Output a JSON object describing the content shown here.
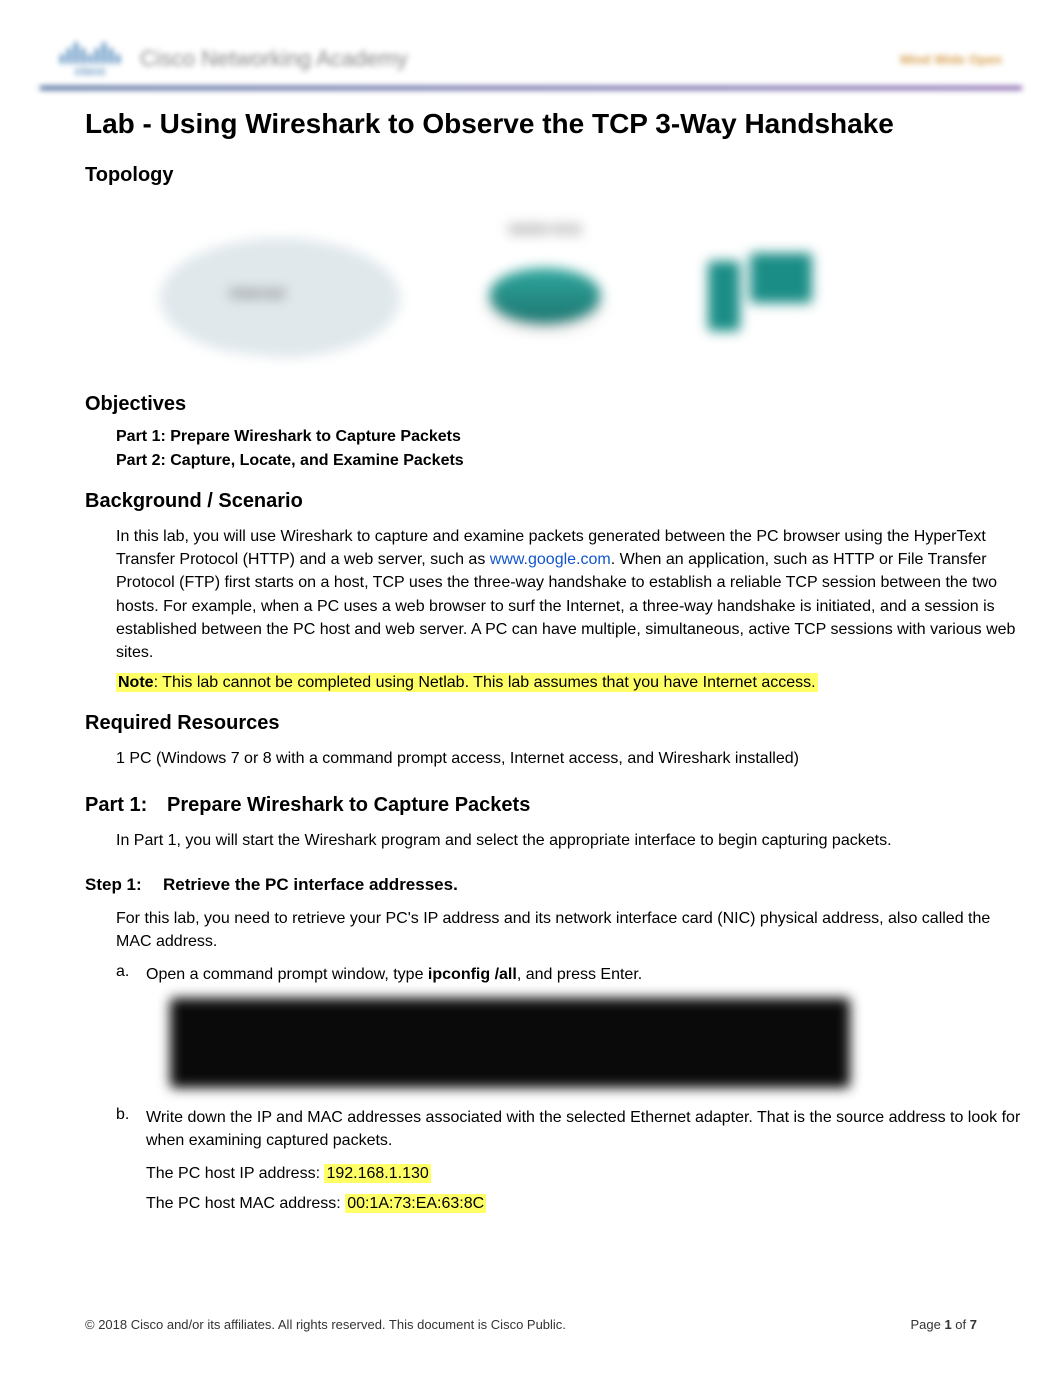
{
  "header": {
    "logo_text": "cisco",
    "academy": "Cisco Networking Academy",
    "tagline": "Mind Wide Open"
  },
  "title": "Lab - Using Wireshark to Observe the TCP 3-Way Handshake",
  "topology": {
    "heading": "Topology",
    "cloud_label": "Internet",
    "router_label": "S0/0/0 DCE",
    "pc_label": ""
  },
  "objectives": {
    "heading": "Objectives",
    "items": [
      "Part 1: Prepare Wireshark to Capture Packets",
      "Part 2: Capture, Locate, and Examine Packets"
    ]
  },
  "background": {
    "heading": "Background / Scenario",
    "para_pre": "In this lab, you will use Wireshark to capture and examine packets generated between the PC browser using the HyperText Transfer Protocol (HTTP) and a web server, such as ",
    "link_text": "www.google.com",
    "para_post": ". When an application, such as HTTP or File Transfer Protocol (FTP) first starts on a host, TCP uses the three-way handshake to establish a reliable TCP session between the two hosts. For example, when a PC uses a web browser to surf the Internet, a three-way handshake is initiated, and a session is established between the PC host and web server. A PC can have multiple, simultaneous, active TCP sessions with various web sites.",
    "note_label": "Note",
    "note_text": ": This lab cannot be completed using Netlab. This lab assumes that you have Internet access."
  },
  "resources": {
    "heading": "Required Resources",
    "item": "1 PC (Windows 7 or 8 with a command prompt access, Internet access, and Wireshark installed)"
  },
  "part1": {
    "num": "Part 1:",
    "title": "Prepare Wireshark to Capture Packets",
    "desc": "In Part 1, you will start the Wireshark program and select the appropriate interface to begin capturing packets."
  },
  "step1": {
    "num": "Step 1:",
    "title": "Retrieve the PC interface addresses.",
    "desc": "For this lab, you need to retrieve your PC's IP address and its network interface card (NIC) physical address, also called the MAC address.",
    "a_marker": "a.",
    "a_pre": "Open a command prompt window, type ",
    "a_cmd": "ipconfig /all",
    "a_post": ", and press Enter.",
    "b_marker": "b.",
    "b_text": "Write down the IP and MAC addresses associated with the selected Ethernet adapter. That is the source address to look for when examining captured packets.",
    "ip_label": "The PC host IP address: ",
    "ip_value": "192.168.1.130",
    "mac_label": "The PC host MAC address: ",
    "mac_value": "00:1A:73:EA:63:8C"
  },
  "footer": {
    "copyright": "© 2018 Cisco and/or its affiliates. All rights reserved. This document is Cisco Public.",
    "page_label": "Page ",
    "page_current": "1",
    "page_of": " of ",
    "page_total": "7"
  }
}
